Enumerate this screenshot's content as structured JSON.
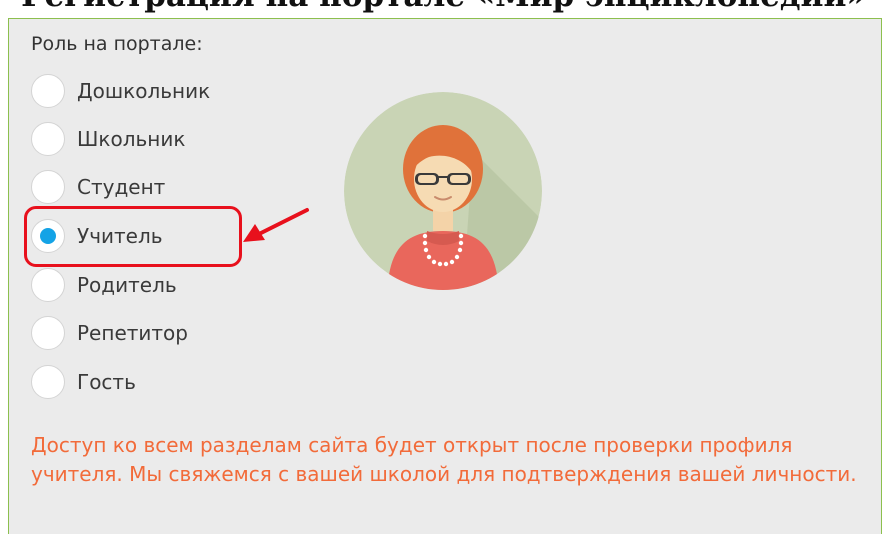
{
  "header": {
    "title": "Регистрация на портале «Мир энциклопедий»"
  },
  "form": {
    "role_label": "Роль на портале:",
    "selected_role": "Учитель",
    "options": [
      {
        "label": "Дошкольник"
      },
      {
        "label": "Школьник"
      },
      {
        "label": "Студент"
      },
      {
        "label": "Учитель"
      },
      {
        "label": "Родитель"
      },
      {
        "label": "Репетитор"
      },
      {
        "label": "Гость"
      }
    ],
    "notice": "Доступ ко всем разделам сайта будет открыт после проверки профиля учителя. Мы свяжемся с вашей школой для подтверждения вашей личности."
  },
  "colors": {
    "accent_radio": "#14a3e6",
    "highlight": "#e8101c",
    "notice_text": "#f26b3a",
    "panel_border": "#8cbf4e",
    "panel_bg": "#ebebeb"
  },
  "icons": {
    "avatar": "teacher-avatar-icon",
    "arrow": "red-arrow-icon"
  }
}
